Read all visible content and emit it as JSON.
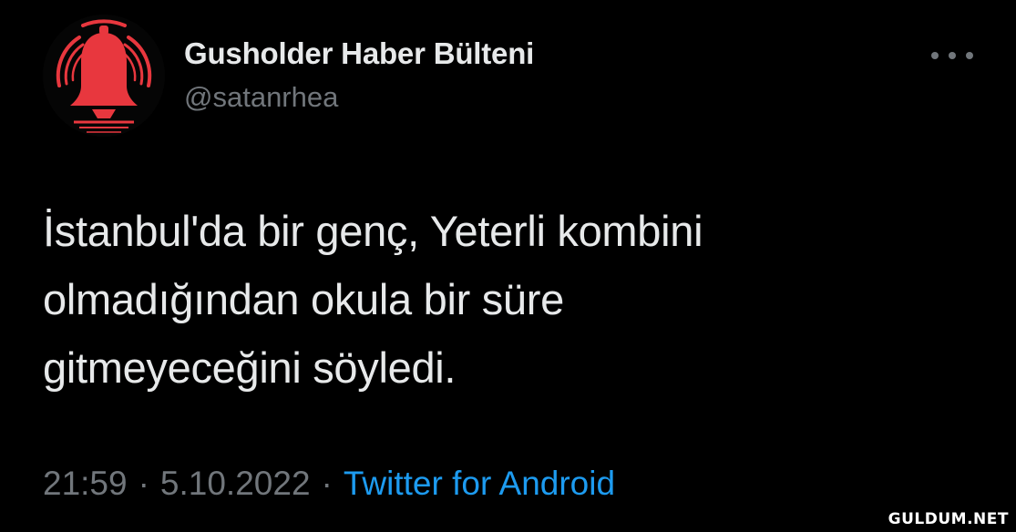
{
  "author": {
    "display_name": "Gusholder Haber Bülteni",
    "handle": "@satanrhea",
    "avatar_icon": "alarm-bell-icon"
  },
  "tweet": {
    "lines": [
      "İstanbul'da bir genç, Yeterli kombini",
      "olmadığından okula bir süre",
      "gitmeyeceğini söyledi."
    ]
  },
  "meta": {
    "time": "21:59",
    "separator": "·",
    "date": "5.10.2022",
    "source": "Twitter for Android"
  },
  "watermark": "GULDUM.NET",
  "colors": {
    "background": "#000000",
    "primary_text": "#e7e9ea",
    "secondary_text": "#71767b",
    "link": "#1d9bf0",
    "avatar_accent": "#e8373e"
  }
}
